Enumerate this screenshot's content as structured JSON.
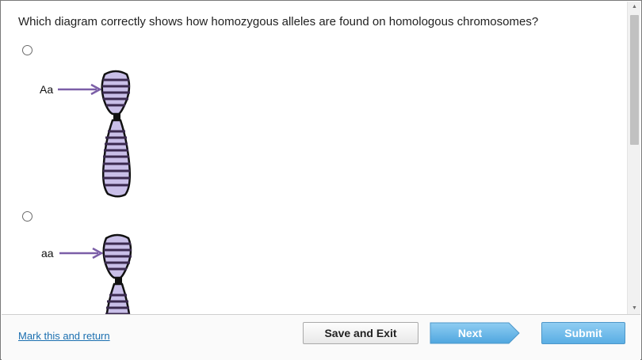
{
  "question": {
    "text": "Which diagram correctly shows how homozygous alleles are found on homologous chromosomes?"
  },
  "options": [
    {
      "allele_label": "Aa"
    },
    {
      "allele_label": "aa"
    }
  ],
  "colors": {
    "chromosome_fill": "#c9bfe8",
    "chromosome_band": "#3b2a4f",
    "arrow": "#7b5ea7",
    "link": "#1b6fb0",
    "next_button": "#5eb2e6",
    "submit_button": "#5aaee4"
  },
  "scrollbar": {
    "up_icon": "triangle-up",
    "down_icon": "triangle-down"
  },
  "footer": {
    "mark_link": "Mark this and return",
    "save_label": "Save and Exit",
    "next_label": "Next",
    "submit_label": "Submit"
  }
}
